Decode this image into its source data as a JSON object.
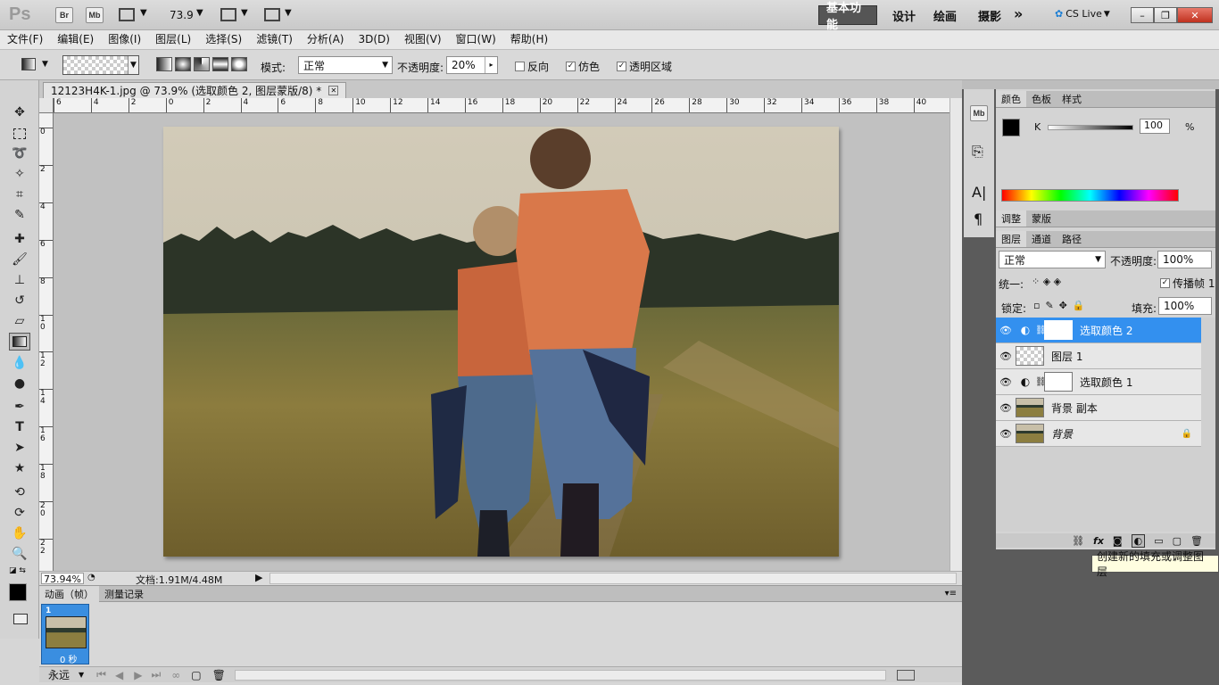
{
  "app": {
    "logo": "Ps",
    "bridge": "Br",
    "minibridge": "Mb",
    "zoom": "73.9"
  },
  "workspaces": [
    "基本功能",
    "设计",
    "绘画",
    "摄影"
  ],
  "cslive": "CS Live",
  "menu": [
    "文件(F)",
    "编辑(E)",
    "图像(I)",
    "图层(L)",
    "选择(S)",
    "滤镜(T)",
    "分析(A)",
    "3D(D)",
    "视图(V)",
    "窗口(W)",
    "帮助(H)"
  ],
  "options": {
    "mode_label": "模式:",
    "mode_value": "正常",
    "opacity_label": "不透明度:",
    "opacity_value": "20%",
    "reverse": "反向",
    "dither": "仿色",
    "transparency": "透明区域"
  },
  "document": {
    "tab_title": "12123H4K-1.jpg @ 73.9% (选取颜色 2, 图层蒙版/8) *",
    "zoom": "73.94%",
    "doc_info": "文档:1.91M/4.48M"
  },
  "ruler": {
    "h": [
      "6",
      "4",
      "2",
      "0",
      "2",
      "4",
      "6",
      "8",
      "10",
      "12",
      "14",
      "16",
      "18",
      "20",
      "22",
      "24",
      "26",
      "28",
      "30",
      "32",
      "34",
      "36",
      "38",
      "40"
    ],
    "v": [
      "0",
      "2",
      "4",
      "6",
      "8",
      "1 0",
      "1 2",
      "1 4",
      "1 6",
      "1 8",
      "2 0",
      "2 2"
    ]
  },
  "animation": {
    "tabs": [
      "动画（帧）",
      "测量记录"
    ],
    "frame_no": "1",
    "frame_time": "0 秒",
    "loop": "永远"
  },
  "color_panel": {
    "tabs": [
      "颜色",
      "色板",
      "样式"
    ],
    "channel": "K",
    "value": "100",
    "unit": "%"
  },
  "adjust_panel": {
    "tabs": [
      "调整",
      "蒙版"
    ]
  },
  "layers_panel": {
    "tabs": [
      "图层",
      "通道",
      "路径"
    ],
    "blend": "正常",
    "opacity_label": "不透明度:",
    "opacity": "100%",
    "unify_label": "统一:",
    "propagate": "传播帧 1",
    "lock_label": "锁定:",
    "fill_label": "填充:",
    "fill": "100%",
    "layers": [
      {
        "name": "选取颜色 2",
        "type": "adjust",
        "selected": true
      },
      {
        "name": "图层 1",
        "type": "pixel",
        "selected": false
      },
      {
        "name": "选取颜色 1",
        "type": "adjust",
        "selected": false
      },
      {
        "name": "背景 副本",
        "type": "photo",
        "selected": false
      },
      {
        "name": "背景",
        "type": "photo-locked",
        "selected": false
      }
    ]
  },
  "tooltip": "创建新的填充或调整图层"
}
